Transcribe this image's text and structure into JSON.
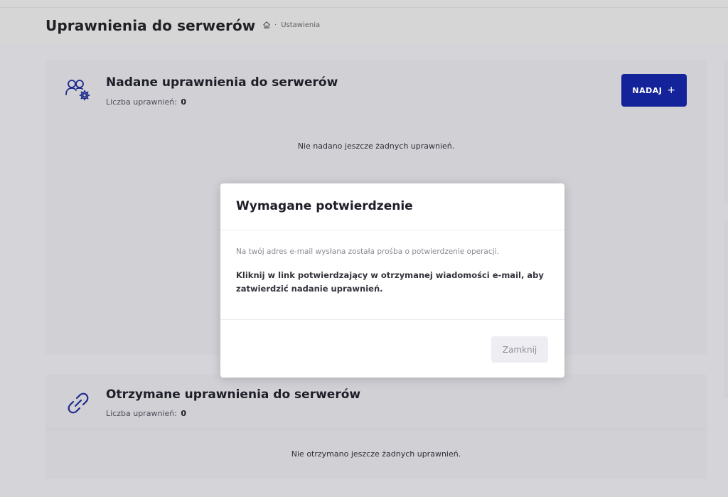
{
  "header": {
    "title": "Uprawnienia do serwerów",
    "breadcrumb": {
      "home_icon": "home-icon",
      "current": "Ustawienia"
    }
  },
  "granted": {
    "icon": "users-gear-icon",
    "title": "Nadane uprawnienia do serwerów",
    "count_label": "Liczba uprawnień:",
    "count_value": "0",
    "empty_message": "Nie nadano jeszcze żadnych uprawnień.",
    "grant_button_label": "NADAJ",
    "grant_button_icon": "plus-icon"
  },
  "received": {
    "icon": "link-icon",
    "title": "Otrzymane uprawnienia do serwerów",
    "count_label": "Liczba uprawnień:",
    "count_value": "0",
    "empty_message": "Nie otrzymano jeszcze żadnych uprawnień."
  },
  "modal": {
    "title": "Wymagane potwierdzenie",
    "info": "Na twój adres e-mail wysłana została prośba o potwierdzenie operacji.",
    "instruction": "Kliknij w link potwierdzający w otrzymanej wiadomości e-mail, aby zatwierdzić nadanie uprawnień.",
    "close_label": "Zamknij"
  },
  "colors": {
    "accent": "#14239a",
    "icon": "#1f2a8c",
    "overlay_background": "#d4d4d9"
  }
}
